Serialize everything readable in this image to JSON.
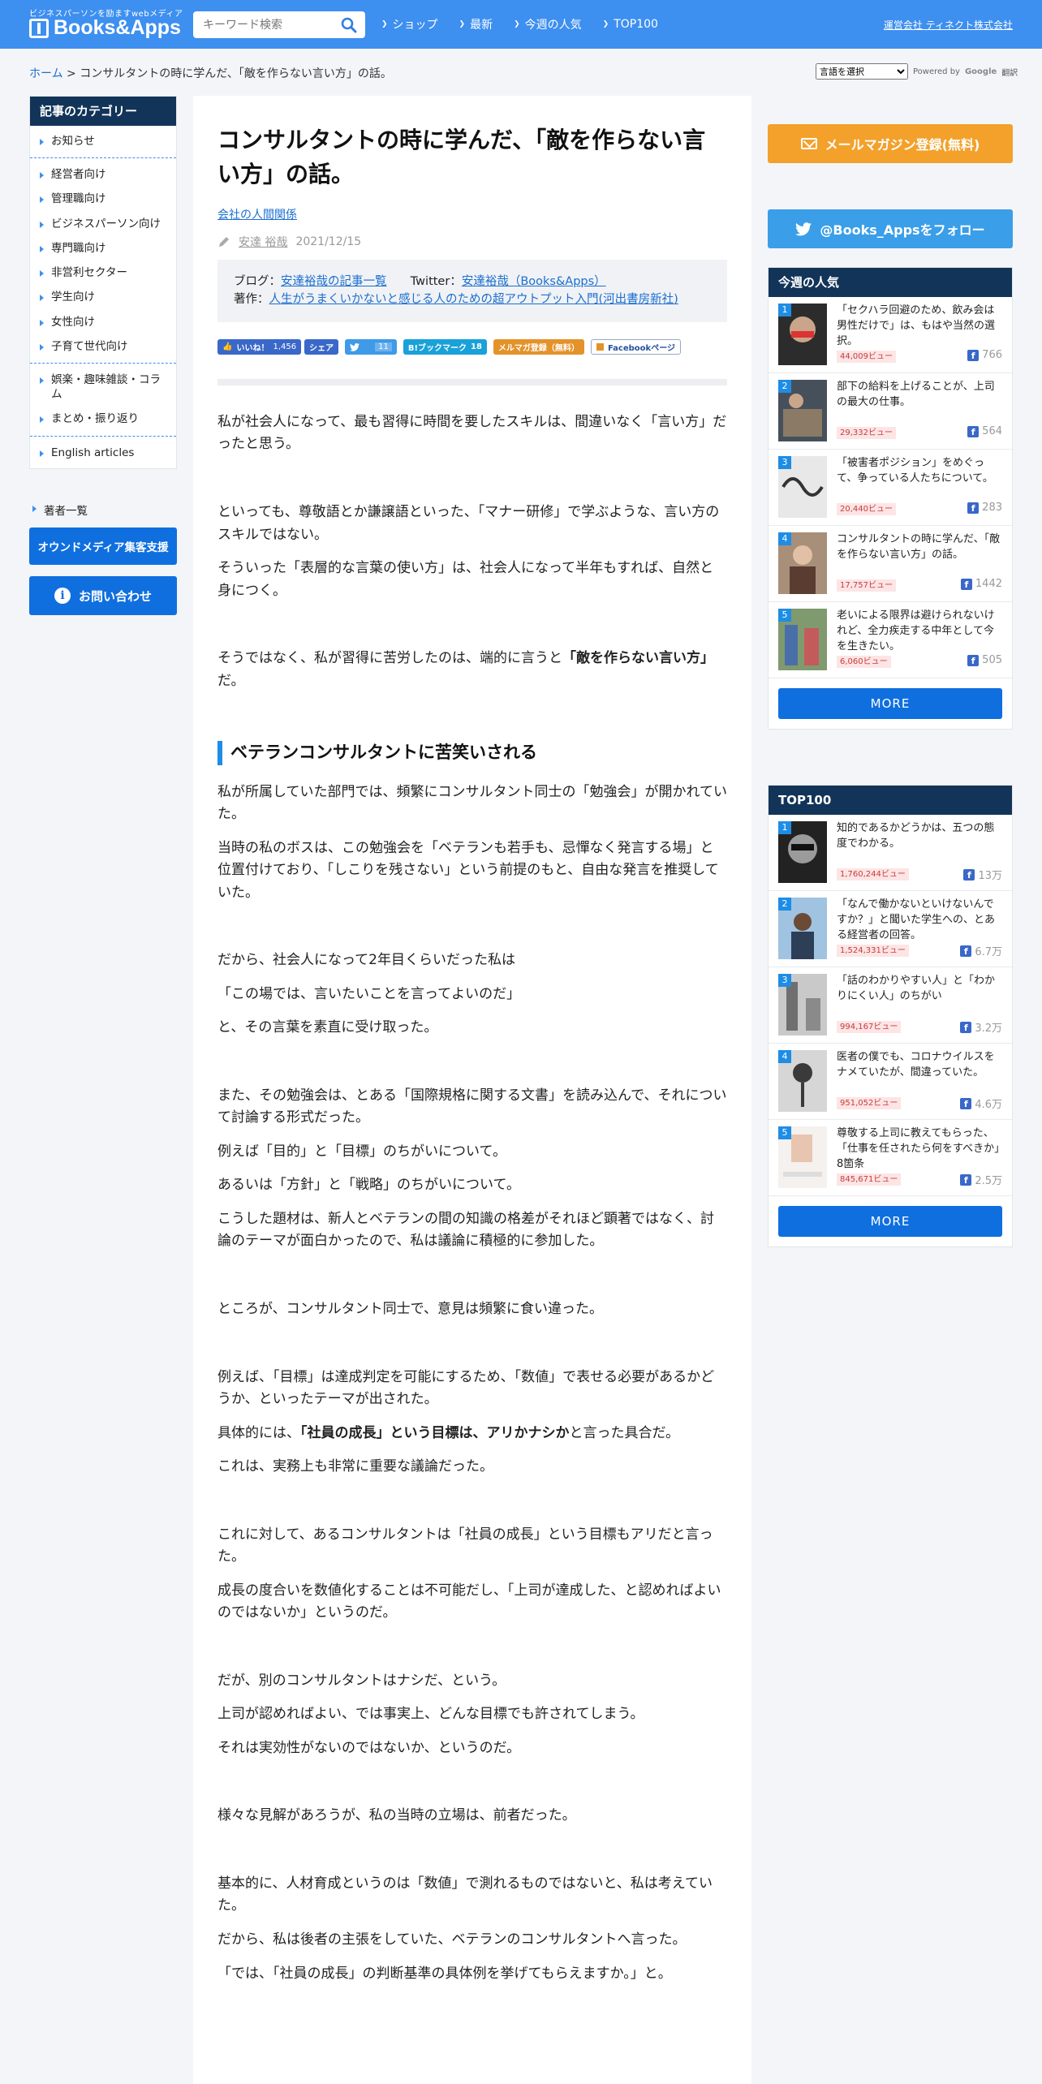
{
  "header": {
    "tagline": "ビジネスパーソンを励ますwebメディア",
    "brand": "Books&Apps",
    "search_placeholder": "キーワード検索",
    "nav": [
      "ショップ",
      "最新",
      "今週の人気",
      "TOP100"
    ],
    "company_link": "運営会社 ティネクト株式会社"
  },
  "breadcrumb": {
    "home": "ホーム",
    "separator": ">",
    "current": "コンサルタントの時に学んだ、「敵を作らない言い方」の話。"
  },
  "translate": {
    "select_label": "言語を選択",
    "powered_by": "Powered by",
    "google": "Google",
    "translate_word": "翻訳"
  },
  "sidebar": {
    "heading": "記事のカテゴリー",
    "groups": [
      [
        "お知らせ"
      ],
      [
        "経営者向け",
        "管理職向け",
        "ビジネスパーソン向け",
        "専門職向け",
        "非営利セクター",
        "学生向け",
        "女性向け",
        "子育て世代向け"
      ],
      [
        "娯楽・趣味雑談・コラム",
        "まとめ・振り返り"
      ],
      [
        "English articles"
      ]
    ],
    "authors": "著者一覧",
    "owned_media_button": "オウンドメディア集客支援",
    "contact_button": "お問い合わせ"
  },
  "article": {
    "title": "コンサルタントの時に学んだ、「敵を作らない言い方」の話。",
    "category": "会社の人間関係",
    "author": "安達 裕哉",
    "date": "2021/12/15",
    "author_box": {
      "blog_label": "ブログ：",
      "blog_link": "安達裕哉の記事一覧",
      "twitter_label": "Twitter：",
      "twitter_link": "安達裕哉（Books&Apps）",
      "book_label": "著作：",
      "book_link": "人生がうまくいかないと感じる人のための超アウトプット入門(河出書房新社)"
    },
    "share": {
      "like_label": "いいね！",
      "like_count": "1,456",
      "share_label": "シェア",
      "tweet_count": "11",
      "hatena_label": "B!ブックマーク",
      "hatena_count": "18",
      "mailmag_label": "メルマガ登録（無料）",
      "fbpage_label": "Facebookページ"
    },
    "p1": "私が社会人になって、最も習得に時間を要したスキルは、間違いなく「言い方」だったと思う。",
    "p2": "といっても、尊敬語とか謙譲語といった、「マナー研修」で学ぶような、言い方のスキルではない。",
    "p3": "そういった「表層的な言葉の使い方」は、社会人になって半年もすれば、自然と身につく。",
    "p4a": "そうではなく、私が習得に苦労したのは、端的に言うと",
    "p4b": "「敵を作らない言い方」",
    "p4c": "だ。",
    "h2": "ベテランコンサルタントに苦笑いされる",
    "p5": "私が所属していた部門では、頻繁にコンサルタント同士の「勉強会」が開かれていた。",
    "p6": "当時の私のボスは、この勉強会を「ベテランも若手も、忌憚なく発言する場」と位置付けており、「しこりを残さない」という前提のもと、自由な発言を推奨していた。",
    "p7": "だから、社会人になって2年目くらいだった私は",
    "p8": "「この場では、言いたいことを言ってよいのだ」",
    "p9": "と、その言葉を素直に受け取った。",
    "p10": "また、その勉強会は、とある「国際規格に関する文書」を読み込んで、それについて討論する形式だった。",
    "p11": "例えば「目的」と「目標」のちがいについて。",
    "p12": "あるいは「方針」と「戦略」のちがいについて。",
    "p13": "こうした題材は、新人とベテランの間の知識の格差がそれほど顕著ではなく、討論のテーマが面白かったので、私は議論に積極的に参加した。",
    "p14": "ところが、コンサルタント同士で、意見は頻繁に食い違った。",
    "p15": "例えば、「目標」は達成判定を可能にするため、「数値」で表せる必要があるかどうか、といったテーマが出された。",
    "p16a": "具体的には、",
    "p16b": "「社員の成長」という目標は、アリかナシか",
    "p16c": "と言った具合だ。",
    "p17": "これは、実務上も非常に重要な議論だった。",
    "p18": "これに対して、あるコンサルタントは「社員の成長」という目標もアリだと言った。",
    "p19": "成長の度合いを数値化することは不可能だし、「上司が達成した、と認めればよいのではないか」というのだ。",
    "p20": "だが、別のコンサルタントはナシだ、という。",
    "p21": "上司が認めればよい、では事実上、どんな目標でも許されてしまう。",
    "p22": "それは実効性がないのではないか、というのだ。",
    "p23": "様々な見解があろうが、私の当時の立場は、前者だった。",
    "p24": "基本的に、人材育成というのは「数値」で測れるものではないと、私は考えていた。",
    "p25": "だから、私は後者の主張をしていた、ベテランのコンサルタントへ言った。",
    "p26": "「では、「社員の成長」の判断基準の具体例を挙げてもらえますか。」と。"
  },
  "right": {
    "mail_button": "メールマガジン登録(無料)",
    "follow_button": "@Books_Appsをフォロー",
    "weekly": {
      "heading": "今週の人気",
      "items": [
        {
          "rank": "1",
          "title": "「セクハラ回避のため、飲み会は男性だけで」は、もはや当然の選択。",
          "views": "44,009ビュー",
          "likes": "766"
        },
        {
          "rank": "2",
          "title": "部下の給料を上げることが、上司の最大の仕事。",
          "views": "29,332ビュー",
          "likes": "564"
        },
        {
          "rank": "3",
          "title": "「被害者ポジション」をめぐって、争っている人たちについて。",
          "views": "20,440ビュー",
          "likes": "283"
        },
        {
          "rank": "4",
          "title": "コンサルタントの時に学んだ、「敵を作らない言い方」の話。",
          "views": "17,757ビュー",
          "likes": "1442"
        },
        {
          "rank": "5",
          "title": "老いによる限界は避けられないけれど、全力疾走する中年として今を生きたい。",
          "views": "6,060ビュー",
          "likes": "505"
        }
      ],
      "more": "MORE"
    },
    "top100": {
      "heading": "TOP100",
      "items": [
        {
          "rank": "1",
          "title": "知的であるかどうかは、五つの態度でわかる。",
          "views": "1,760,244ビュー",
          "likes": "13万"
        },
        {
          "rank": "2",
          "title": "「なんで働かないといけないんですか？」と聞いた学生への、とある経営者の回答。",
          "views": "1,524,331ビュー",
          "likes": "6.7万"
        },
        {
          "rank": "3",
          "title": "「話のわかりやすい人」と「わかりにくい人」のちがい",
          "views": "994,167ビュー",
          "likes": "3.2万"
        },
        {
          "rank": "4",
          "title": "医者の僕でも、コロナウイルスをナメていたが、間違っていた。",
          "views": "951,052ビュー",
          "likes": "4.6万"
        },
        {
          "rank": "5",
          "title": "尊敬する上司に教えてもらった、「仕事を任されたら何をすべきか」8箇条",
          "views": "845,671ビュー",
          "likes": "2.5万"
        }
      ],
      "more": "MORE"
    }
  },
  "colors": {
    "header_bg": "#3d8ff0",
    "panel_head": "#123459",
    "button_blue": "#0f6fdf",
    "mail_orange": "#f3a12b",
    "twitter_blue": "#3a9ee9"
  }
}
